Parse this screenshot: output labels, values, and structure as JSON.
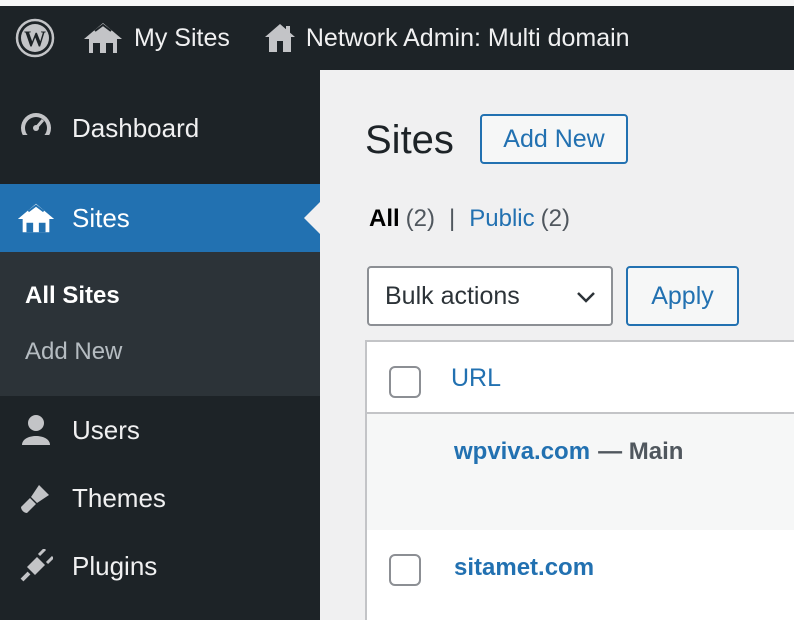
{
  "adminbar": {
    "my_sites": "My Sites",
    "network_admin": "Network Admin: Multi domain"
  },
  "sidebar": {
    "items": [
      {
        "label": "Dashboard",
        "icon": "dashboard-icon"
      },
      {
        "label": "Sites",
        "icon": "sites-icon",
        "active": true
      },
      {
        "label": "Users",
        "icon": "users-icon"
      },
      {
        "label": "Themes",
        "icon": "themes-icon"
      },
      {
        "label": "Plugins",
        "icon": "plugins-icon"
      }
    ],
    "submenu": [
      {
        "label": "All Sites",
        "current": true
      },
      {
        "label": "Add New"
      }
    ]
  },
  "main": {
    "title": "Sites",
    "add_new": "Add New",
    "filters": {
      "all_label": "All",
      "all_count": "(2)",
      "separator": "|",
      "public_label": "Public",
      "public_count": "(2)"
    },
    "bulk_actions": "Bulk actions",
    "apply": "Apply",
    "table": {
      "column_url": "URL",
      "rows": [
        {
          "url": "wpviva.com",
          "suffix": "— Main"
        },
        {
          "url": "sitamet.com"
        }
      ]
    }
  },
  "colors": {
    "adminbar_bg": "#1d2327",
    "accent": "#2271b1",
    "submenu_bg": "#2c3338"
  }
}
